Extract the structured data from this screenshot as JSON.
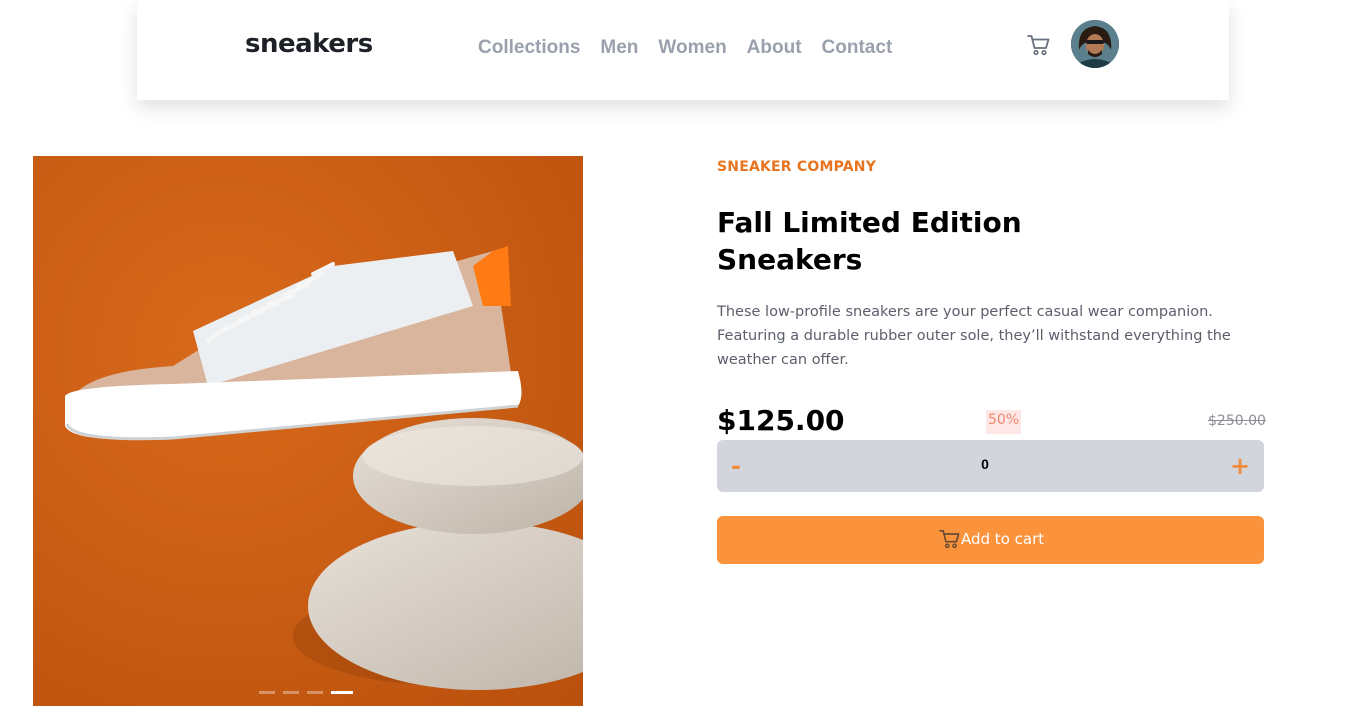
{
  "header": {
    "logo": "sneakers",
    "nav": [
      "Collections",
      "Men",
      "Women",
      "About",
      "Contact"
    ]
  },
  "icons": {
    "cart": "cart-icon",
    "avatar": "avatar"
  },
  "gallery": {
    "slide_count": 4,
    "active_slide": 4
  },
  "product": {
    "company": "SNEAKER COMPANY",
    "title_line1": "Fall Limited Edition",
    "title_line2": "Sneakers",
    "description": "These low-profile sneakers are your perfect casual wear companion. Featuring a durable rubber outer sole, they’ll withstand everything the weather can offer.",
    "price": "$125.00",
    "discount": "50%",
    "original_price": "$250.00"
  },
  "quantity": {
    "minus_label": "-",
    "value": "0",
    "plus_label": "+"
  },
  "add_to_cart": {
    "label": "Add to cart"
  },
  "colors": {
    "accent": "#fb923c",
    "company_text": "#e8741f",
    "discount_bg": "#fde7e7",
    "discount_text": "#f08a6d",
    "quantity_bg": "#d3d5dd",
    "nav_text": "#9aa1ad",
    "gallery_bg": "#c85a10"
  }
}
